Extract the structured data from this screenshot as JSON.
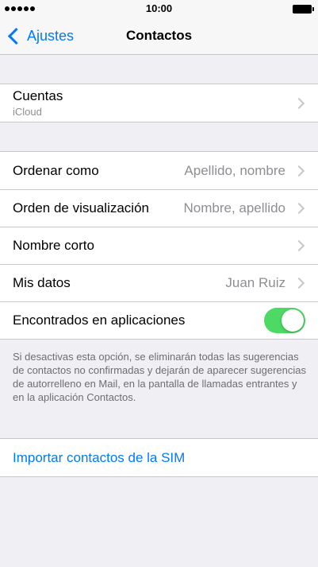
{
  "status_bar": {
    "time": "10:00"
  },
  "nav": {
    "back_label": "Ajustes",
    "title": "Contactos"
  },
  "accounts": {
    "label": "Cuentas",
    "subtitle": "iCloud"
  },
  "settings": {
    "sort_label": "Ordenar como",
    "sort_value": "Apellido, nombre",
    "display_label": "Orden de visualización",
    "display_value": "Nombre, apellido",
    "short_name_label": "Nombre corto",
    "my_info_label": "Mis datos",
    "my_info_value": "Juan Ruiz",
    "found_in_apps_label": "Encontrados en aplicaciones",
    "found_in_apps_enabled": true
  },
  "footer": {
    "note": "Si desactivas esta opción, se eliminarán todas las sugerencias de contactos no confirmadas y dejarán de aparecer sugerencias de autorrelleno en Mail, en la pantalla de llamadas entrantes y en la aplicación Contactos."
  },
  "import": {
    "label": "Importar contactos de la SIM"
  },
  "colors": {
    "accent": "#007aff",
    "toggle_on": "#4cd964",
    "background": "#efeff4"
  }
}
